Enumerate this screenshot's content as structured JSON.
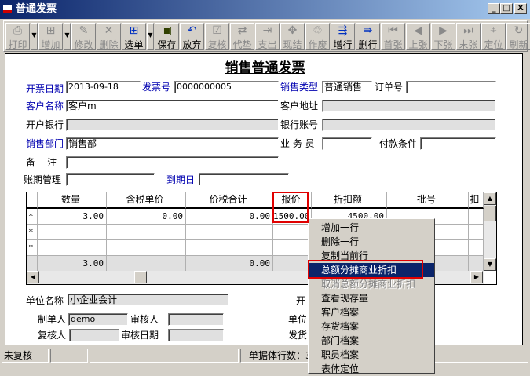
{
  "window": {
    "title": "普通发票",
    "min": "_",
    "max": "□",
    "close": "X"
  },
  "toolbar": [
    {
      "label": "打印",
      "icon": "printer-icon",
      "glyph": "⎙",
      "enabled": false
    },
    {
      "label": "增加",
      "icon": "add-doc-icon",
      "glyph": "⊞",
      "enabled": false
    },
    {
      "label": "修改",
      "icon": "edit-icon",
      "glyph": "✎",
      "enabled": false
    },
    {
      "label": "删除",
      "icon": "delete-icon",
      "glyph": "✕",
      "enabled": false
    },
    {
      "label": "选单",
      "icon": "select-doc-icon",
      "glyph": "⊞",
      "enabled": true
    },
    {
      "label": "保存",
      "icon": "save-icon",
      "glyph": "▣",
      "enabled": true
    },
    {
      "label": "放弃",
      "icon": "undo-icon",
      "glyph": "↶",
      "enabled": true
    },
    {
      "label": "复核",
      "icon": "review-icon",
      "glyph": "☑",
      "enabled": false
    },
    {
      "label": "代垫",
      "icon": "advance-icon",
      "glyph": "⇄",
      "enabled": false
    },
    {
      "label": "支出",
      "icon": "expense-icon",
      "glyph": "⇥",
      "enabled": false
    },
    {
      "label": "现结",
      "icon": "cash-icon",
      "glyph": "✥",
      "enabled": false
    },
    {
      "label": "作废",
      "icon": "trash-icon",
      "glyph": "♲",
      "enabled": false
    },
    {
      "label": "增行",
      "icon": "add-row-icon",
      "glyph": "⇶",
      "enabled": true
    },
    {
      "label": "删行",
      "icon": "delete-row-icon",
      "glyph": "⇛",
      "enabled": true
    },
    {
      "label": "首张",
      "icon": "first-icon",
      "glyph": "⏮",
      "enabled": false
    },
    {
      "label": "上张",
      "icon": "prev-icon",
      "glyph": "◀",
      "enabled": false
    },
    {
      "label": "下张",
      "icon": "next-icon",
      "glyph": "▶",
      "enabled": false
    },
    {
      "label": "末张",
      "icon": "last-icon",
      "glyph": "⏭",
      "enabled": false
    },
    {
      "label": "定位",
      "icon": "locate-icon",
      "glyph": "⌖",
      "enabled": false
    },
    {
      "label": "刷新",
      "icon": "refresh-icon",
      "glyph": "↻",
      "enabled": false
    }
  ],
  "doc_title": "销售普通发票",
  "header": {
    "invoice_date": {
      "label": "开票日期",
      "value": "2013-09-18"
    },
    "invoice_no": {
      "label": "发票号",
      "value": "0000000005"
    },
    "sale_type": {
      "label": "销售类型",
      "value": "普通销售"
    },
    "order_no": {
      "label": "订单号",
      "value": ""
    },
    "customer": {
      "label": "客户名称",
      "value": "客户m"
    },
    "customer_address": {
      "label": "客户地址",
      "value": ""
    },
    "bank": {
      "label": "开户银行",
      "value": ""
    },
    "bank_account": {
      "label": "银行账号",
      "value": ""
    },
    "department": {
      "label": "销售部门",
      "value": "销售部"
    },
    "salesman": {
      "label": "业 务 员",
      "value": ""
    },
    "payment_terms": {
      "label": "付款条件",
      "value": ""
    },
    "remark": {
      "label": "备    注",
      "value": ""
    },
    "credit_mgmt": {
      "label": "账期管理",
      "value": ""
    },
    "due_date": {
      "label": "到期日",
      "value": ""
    }
  },
  "grid": {
    "columns": [
      "数量",
      "含税单价",
      "价税合计",
      "报价",
      "折扣额",
      "批号",
      "扣"
    ],
    "rows": [
      {
        "marker": "*",
        "cells": [
          "3.00",
          "0.00",
          "0.00",
          "1500.00",
          "4500.00",
          "",
          ""
        ]
      },
      {
        "marker": "*",
        "cells": [
          "",
          "",
          "",
          "",
          "",
          "",
          ""
        ]
      },
      {
        "marker": "*",
        "cells": [
          "",
          "",
          "",
          "",
          "",
          "",
          ""
        ]
      }
    ],
    "totals": [
      "3.00",
      "",
      "0.00",
      "",
      "",
      "",
      ""
    ]
  },
  "footer": {
    "company": {
      "label": "单位名称",
      "value": "小企业会计"
    },
    "open_label": "开",
    "maker": {
      "label": "制单人",
      "value": "demo"
    },
    "auditor": {
      "label": "审核人",
      "value": ""
    },
    "reviewer": {
      "label": "复核人",
      "value": ""
    },
    "audit_date": {
      "label": "审核日期",
      "value": ""
    },
    "unit_label": "单位",
    "ship_label": "发货"
  },
  "context_menu": {
    "items": [
      {
        "label": "增加一行",
        "state": "normal"
      },
      {
        "label": "删除一行",
        "state": "normal"
      },
      {
        "label": "复制当前行",
        "state": "normal"
      },
      {
        "label": "总额分摊商业折扣",
        "state": "selected"
      },
      {
        "label": "取消总额分摊商业折扣",
        "state": "disabled"
      },
      {
        "label": "查看现存量",
        "state": "normal"
      },
      {
        "label": "客户档案",
        "state": "normal"
      },
      {
        "label": "存货档案",
        "state": "normal"
      },
      {
        "label": "部门档案",
        "state": "normal"
      },
      {
        "label": "职员档案",
        "state": "normal"
      },
      {
        "label": "表体定位",
        "state": "normal"
      }
    ]
  },
  "status": {
    "review": "未复核",
    "rows_label": "单据体行数：3"
  }
}
